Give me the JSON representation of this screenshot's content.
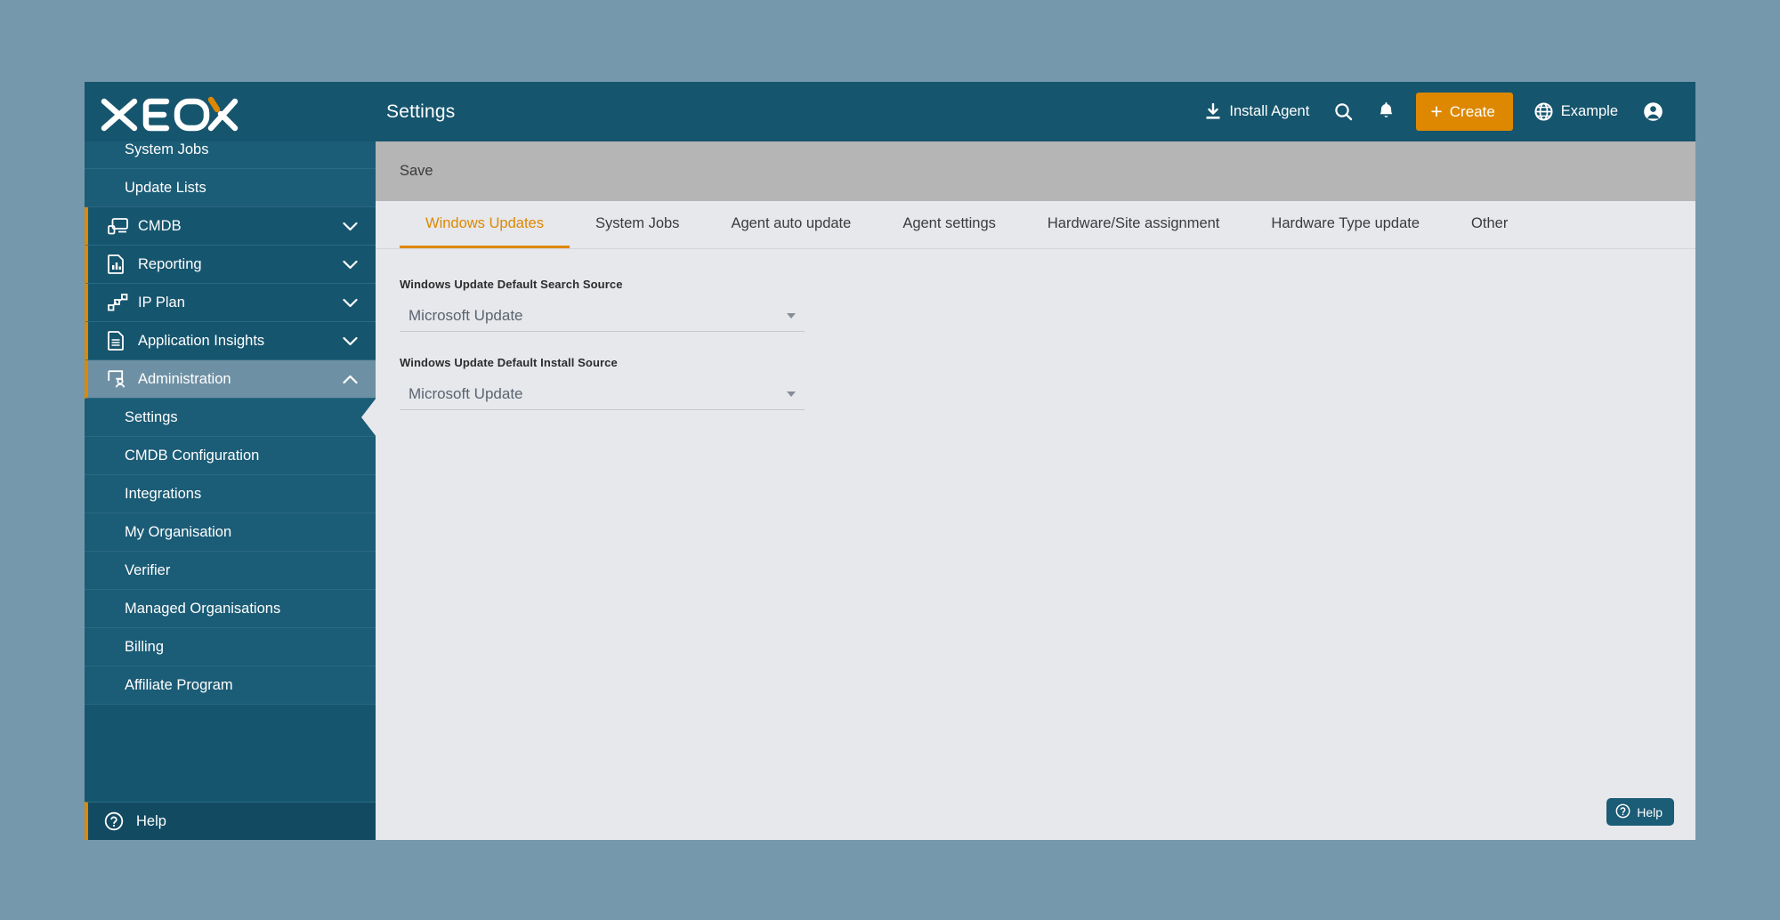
{
  "brand": {
    "logo_text": "XEOX",
    "accent_color": "#dd8800",
    "primary_color": "#16556e"
  },
  "header": {
    "title": "Settings",
    "install_agent_label": "Install Agent",
    "create_label": "Create",
    "tenant_label": "Example"
  },
  "sidebar": {
    "items": [
      {
        "label": "System Jobs",
        "type": "sub"
      },
      {
        "label": "Update Lists",
        "type": "sub"
      },
      {
        "label": "CMDB",
        "type": "top",
        "icon": "monitor-icon",
        "chevron": "down"
      },
      {
        "label": "Reporting",
        "type": "top",
        "icon": "report-icon",
        "chevron": "down"
      },
      {
        "label": "IP Plan",
        "type": "top",
        "icon": "network-icon",
        "chevron": "down"
      },
      {
        "label": "Application Insights",
        "type": "top",
        "icon": "document-icon",
        "chevron": "down"
      },
      {
        "label": "Administration",
        "type": "top",
        "icon": "admin-user-icon",
        "chevron": "up",
        "expanded": true
      },
      {
        "label": "Settings",
        "type": "sub",
        "active": true
      },
      {
        "label": "CMDB Configuration",
        "type": "sub"
      },
      {
        "label": "Integrations",
        "type": "sub"
      },
      {
        "label": "My Organisation",
        "type": "sub"
      },
      {
        "label": "Verifier",
        "type": "sub"
      },
      {
        "label": "Managed Organisations",
        "type": "sub"
      },
      {
        "label": "Billing",
        "type": "sub"
      },
      {
        "label": "Affiliate Program",
        "type": "sub"
      }
    ],
    "help_label": "Help"
  },
  "actionbar": {
    "save_label": "Save"
  },
  "tabs": [
    {
      "label": "Windows Updates",
      "active": true
    },
    {
      "label": "System Jobs",
      "active": false
    },
    {
      "label": "Agent auto update",
      "active": false
    },
    {
      "label": "Agent settings",
      "active": false
    },
    {
      "label": "Hardware/Site assignment",
      "active": false
    },
    {
      "label": "Hardware Type update",
      "active": false
    },
    {
      "label": "Other",
      "active": false
    }
  ],
  "form": {
    "fields": [
      {
        "label": "Windows Update Default Search Source",
        "value": "Microsoft Update"
      },
      {
        "label": "Windows Update Default Install Source",
        "value": "Microsoft Update"
      }
    ]
  },
  "help_widget": {
    "label": "Help"
  }
}
